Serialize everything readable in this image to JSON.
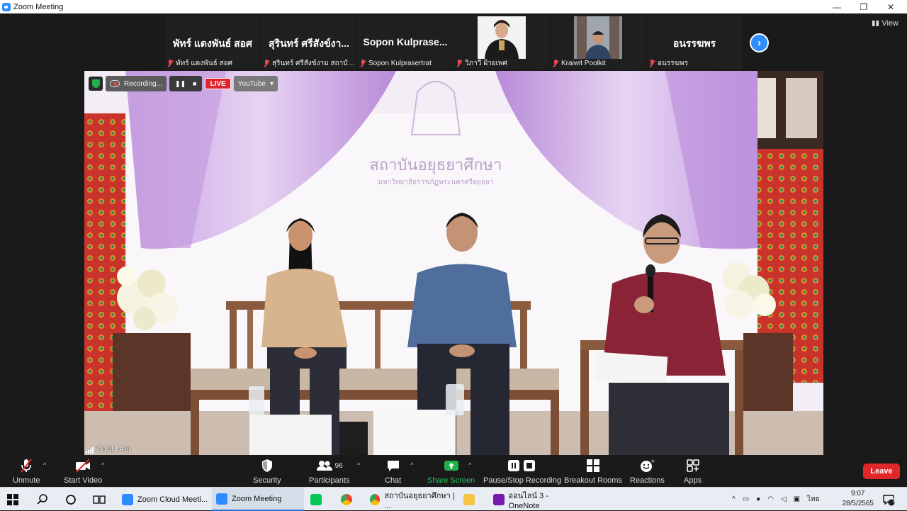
{
  "window": {
    "title": "Zoom Meeting",
    "controls": [
      "—",
      "❐",
      "✕"
    ]
  },
  "gallery": {
    "tiles": [
      {
        "display_name": "พัทร์ แดงพันธ์ สอศ",
        "label": "พัทร์ แดงพันธ์ สอศ",
        "muted": true,
        "video": false
      },
      {
        "display_name": "สุรินทร์ ศรีสังข์งา...",
        "label": "สุรินทร์ ศรีสังข์งาม สถาบัน...",
        "muted": true,
        "video": false
      },
      {
        "display_name": "Sopon Kulprase...",
        "label": "Sopon Kulprasertrat",
        "muted": true,
        "video": false
      },
      {
        "display_name": "",
        "label": "วิภาวี ฝ้ายเพศ",
        "muted": true,
        "video": true
      },
      {
        "display_name": "",
        "label": "Kraiwit Poolkit",
        "muted": true,
        "video": true
      },
      {
        "display_name": "อนรรฆพร",
        "label": "อนรรฆพร",
        "muted": true,
        "video": false
      }
    ],
    "next_icon": "chevron-right-icon",
    "view_label": "View"
  },
  "main_video": {
    "recording_label": "Recording...",
    "live_label": "LIVE",
    "stream_target": "YouTube",
    "banner_line1": "สถาบันอยุธยาศึกษา",
    "banner_line2": "มหาวิทยาลัยราชภัฏพระนครศรีอยุธยา",
    "speaker_label": "ZOOM ASI"
  },
  "toolbar": {
    "unmute": "Unmute",
    "start_video": "Start Video",
    "security": "Security",
    "participants": "Participants",
    "participants_count": "96",
    "chat": "Chat",
    "share_screen": "Share Screen",
    "pause_stop_recording": "Pause/Stop Recording",
    "breakout_rooms": "Breakout Rooms",
    "reactions": "Reactions",
    "apps": "Apps",
    "leave": "Leave"
  },
  "taskbar": {
    "items": [
      {
        "label": "Zoom Cloud Meeti...",
        "icon": "zoom-icon"
      },
      {
        "label": "Zoom Meeting",
        "icon": "zoom-icon",
        "active": true
      },
      {
        "label": "",
        "icon": "line-icon"
      },
      {
        "label": "",
        "icon": "chrome-icon"
      },
      {
        "label": "สถาบันอยุธยาศึกษา | ...",
        "icon": "chrome-icon"
      },
      {
        "label": "",
        "icon": "file-explorer-icon"
      },
      {
        "label": "ออนไลน์ 3 - OneNote",
        "icon": "onenote-icon"
      }
    ],
    "language": "ไทย",
    "time": "9:07",
    "date": "28/5/2565",
    "notification_count": "7"
  },
  "colors": {
    "accent": "#2d8cff",
    "leave": "#e02828",
    "share": "#22b04b",
    "live": "#e0242b"
  }
}
